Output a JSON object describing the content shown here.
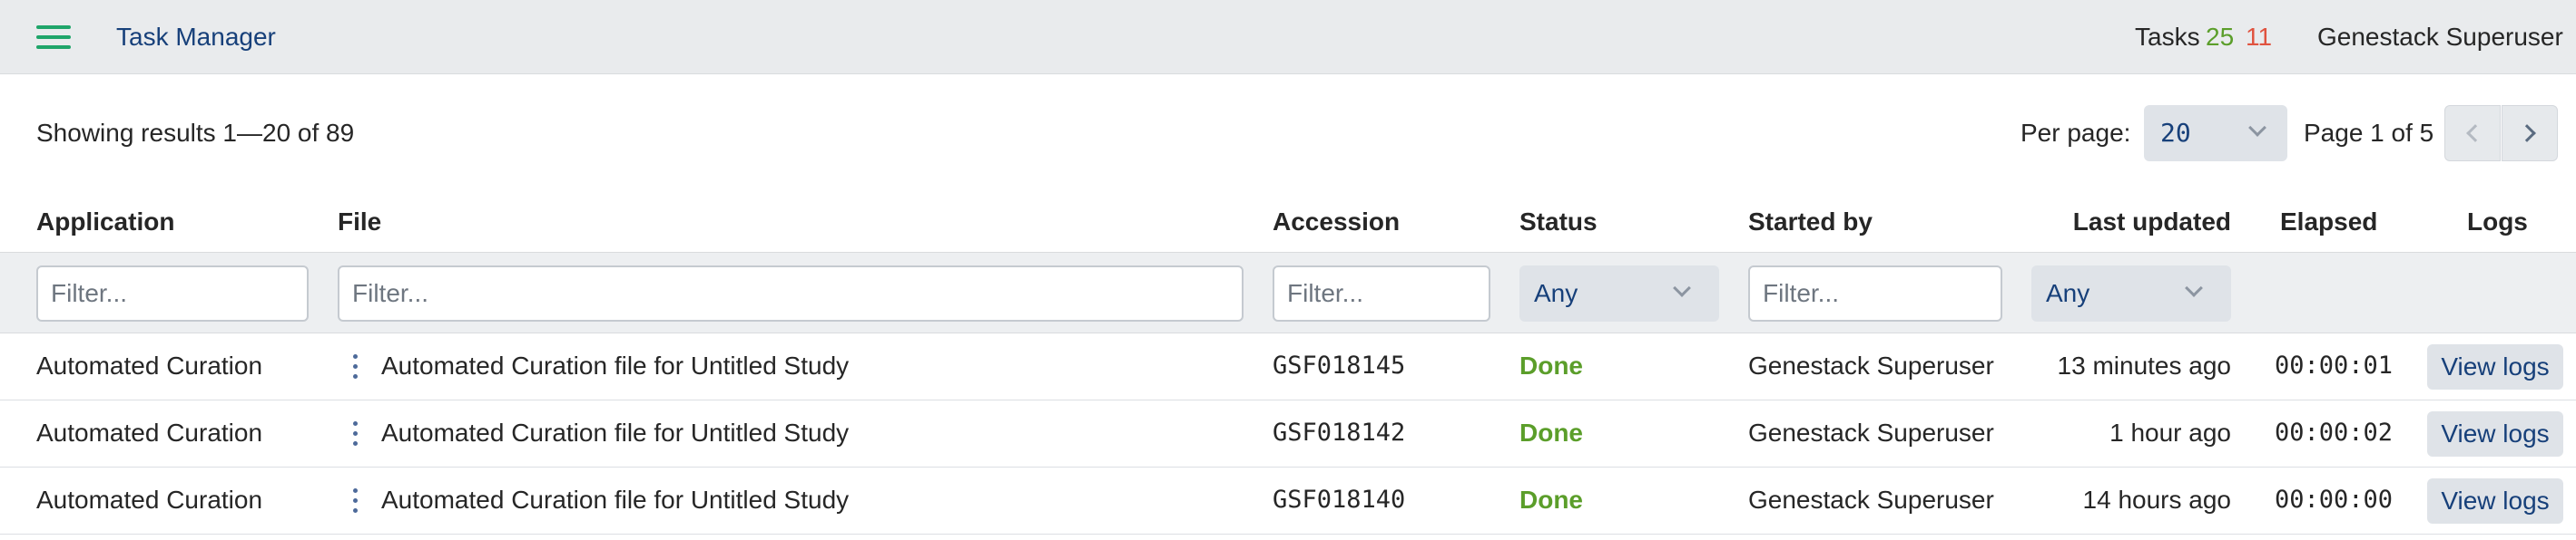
{
  "header": {
    "app_title": "Task Manager",
    "tasks_label": "Tasks",
    "tasks_done": "25",
    "tasks_failed": "11",
    "user_name": "Genestack Superuser",
    "colors": {
      "done": "#5b9e2a",
      "failed": "#e0533f",
      "menu": "#1fa56a"
    }
  },
  "toolbar": {
    "results_text": "Showing results 1—20 of 89",
    "per_page_label": "Per page:",
    "per_page_value": "20",
    "page_text": "Page 1 of 5"
  },
  "columns": [
    "Application",
    "File",
    "Accession",
    "Status",
    "Started by",
    "Last updated",
    "Elapsed",
    "Logs"
  ],
  "filters": {
    "application_placeholder": "Filter...",
    "file_placeholder": "Filter...",
    "accession_placeholder": "Filter...",
    "status_value": "Any",
    "started_by_placeholder": "Filter...",
    "last_updated_value": "Any"
  },
  "rows": [
    {
      "application": "Automated Curation",
      "file": "Automated Curation file for Untitled Study",
      "accession": "GSF018145",
      "status": "Done",
      "started_by": "Genestack Superuser",
      "last_updated": "13 minutes ago",
      "elapsed": "00:00:01",
      "logs": "View logs"
    },
    {
      "application": "Automated Curation",
      "file": "Automated Curation file for Untitled Study",
      "accession": "GSF018142",
      "status": "Done",
      "started_by": "Genestack Superuser",
      "last_updated": "1 hour ago",
      "elapsed": "00:00:02",
      "logs": "View logs"
    },
    {
      "application": "Automated Curation",
      "file": "Automated Curation file for Untitled Study",
      "accession": "GSF018140",
      "status": "Done",
      "started_by": "Genestack Superuser",
      "last_updated": "14 hours ago",
      "elapsed": "00:00:00",
      "logs": "View logs"
    }
  ]
}
